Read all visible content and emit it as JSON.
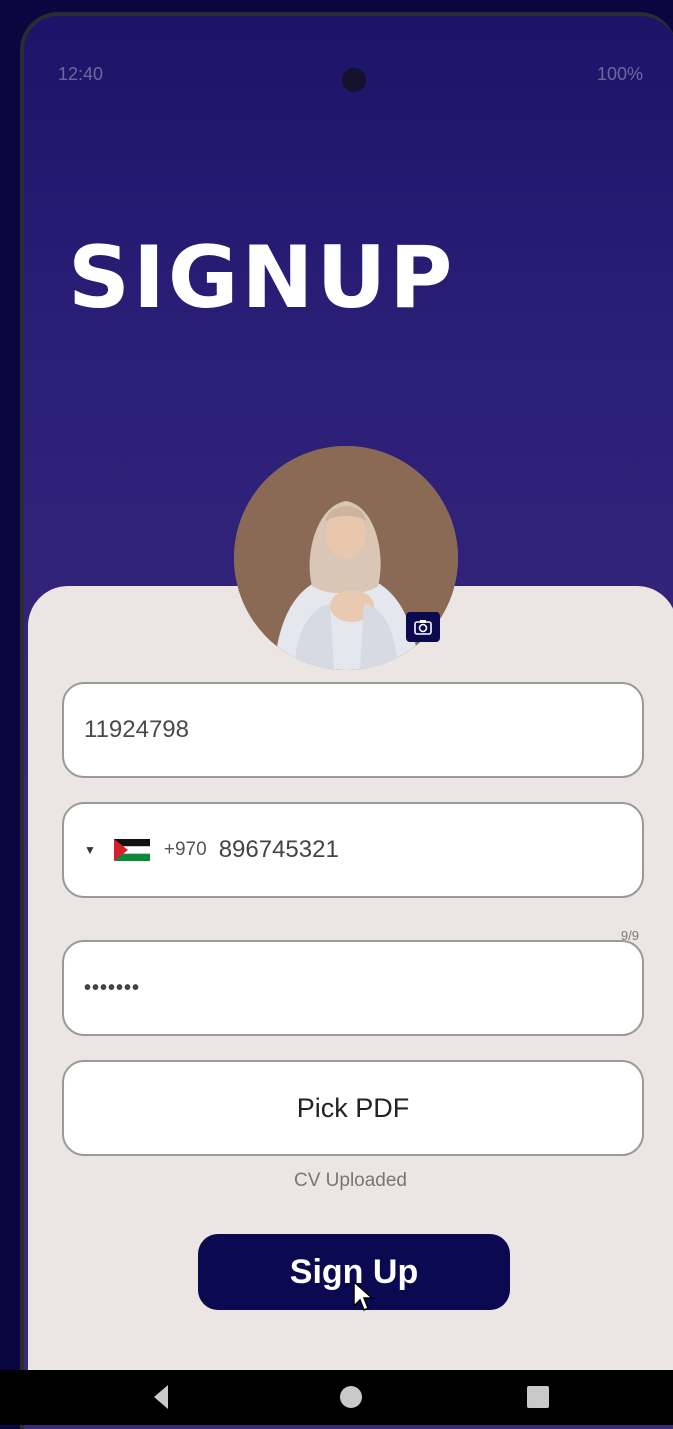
{
  "status_bar": {
    "time": "12:40",
    "right": "100%"
  },
  "screen": {
    "title": "SIGNUP"
  },
  "form": {
    "username_value": "11924798",
    "phone": {
      "country": "Palestine",
      "dial_code": "+970",
      "number": "896745321",
      "counter": "9/9"
    },
    "password_mask": "•••••••",
    "pdf_button_label": "Pick PDF",
    "cv_status": "CV Uploaded",
    "submit_label": "Sign Up"
  },
  "colors": {
    "background": "#0a0640",
    "header_gradient_top": "#1c1468",
    "card": "#ebe5e3",
    "button": "#0b0a50"
  },
  "icons": {
    "camera_badge": "camera-icon",
    "dropdown": "dropdown-arrow-icon",
    "flag": "palestine-flag-icon",
    "nav_back": "back-triangle-icon",
    "nav_home": "home-circle-icon",
    "nav_recent": "recents-square-icon"
  }
}
